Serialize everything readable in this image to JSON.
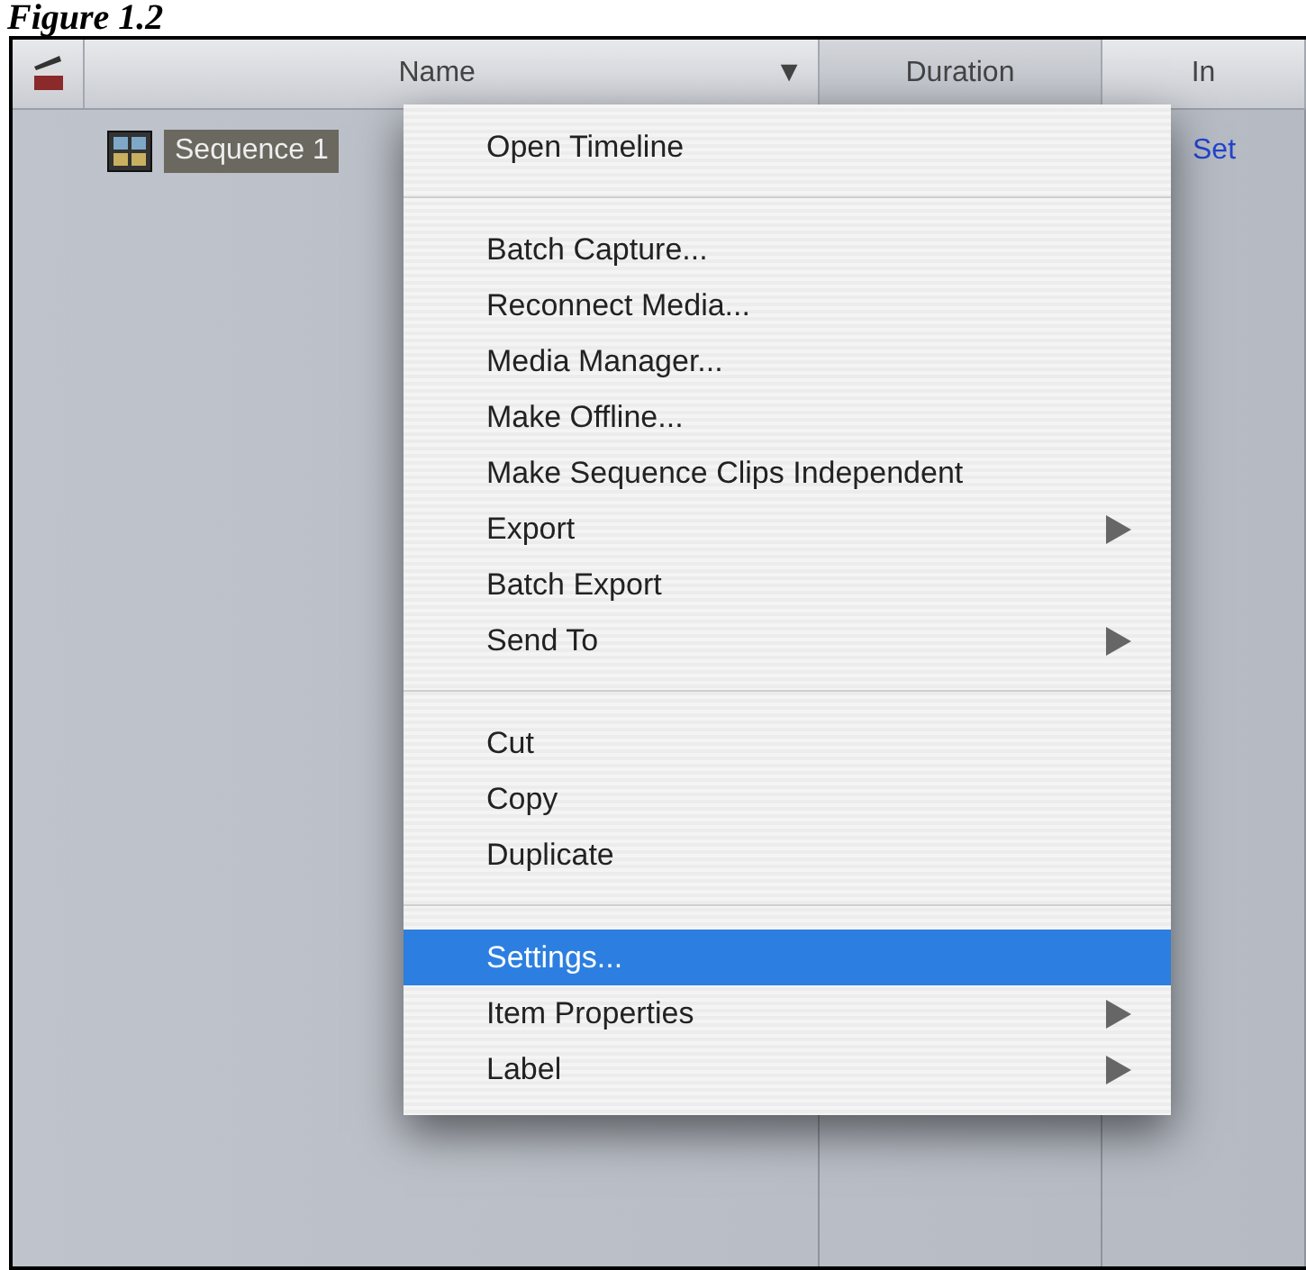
{
  "figure_caption": "Figure 1.2",
  "browser": {
    "columns": [
      {
        "label": "Name",
        "sort_arrow": "▼"
      },
      {
        "label": "Duration"
      },
      {
        "label": "In"
      }
    ],
    "rows": [
      {
        "name": "Sequence 1",
        "selected": true,
        "in": "Set"
      }
    ]
  },
  "context_menu": {
    "groups": [
      [
        {
          "label": "Open Timeline",
          "submenu": false,
          "selected": false
        }
      ],
      [
        {
          "label": "Batch Capture...",
          "submenu": false,
          "selected": false
        },
        {
          "label": "Reconnect Media...",
          "submenu": false,
          "selected": false
        },
        {
          "label": "Media Manager...",
          "submenu": false,
          "selected": false
        },
        {
          "label": "Make Offline...",
          "submenu": false,
          "selected": false
        },
        {
          "label": "Make Sequence Clips Independent",
          "submenu": false,
          "selected": false
        },
        {
          "label": "Export",
          "submenu": true,
          "selected": false
        },
        {
          "label": "Batch Export",
          "submenu": false,
          "selected": false
        },
        {
          "label": "Send To",
          "submenu": true,
          "selected": false
        }
      ],
      [
        {
          "label": "Cut",
          "submenu": false,
          "selected": false
        },
        {
          "label": "Copy",
          "submenu": false,
          "selected": false
        },
        {
          "label": "Duplicate",
          "submenu": false,
          "selected": false
        }
      ],
      [
        {
          "label": "Settings...",
          "submenu": false,
          "selected": true
        },
        {
          "label": "Item Properties",
          "submenu": true,
          "selected": false
        },
        {
          "label": "Label",
          "submenu": true,
          "selected": false
        }
      ]
    ]
  }
}
